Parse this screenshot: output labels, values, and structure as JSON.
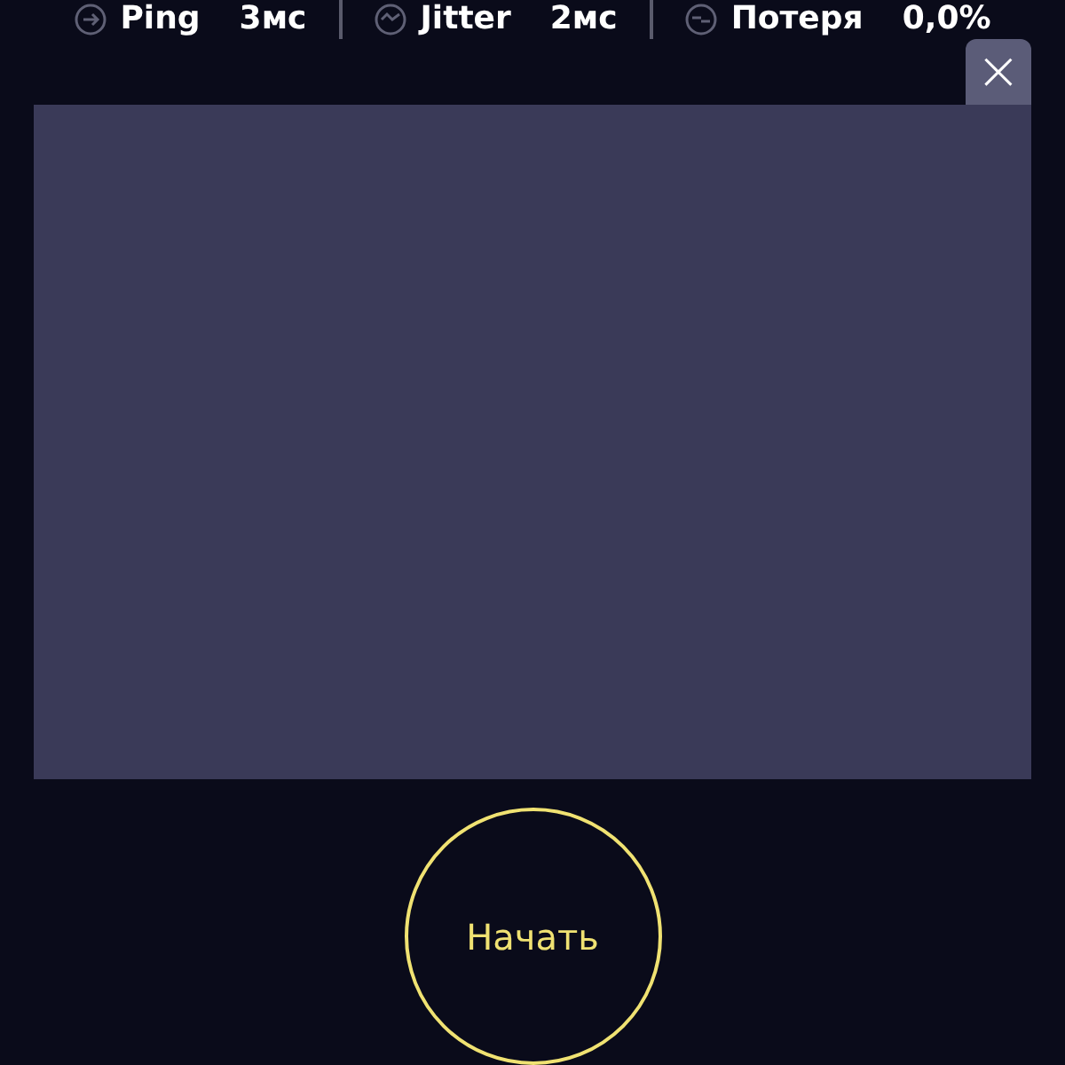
{
  "stats": [
    {
      "label": "Ping",
      "value": "3мс"
    },
    {
      "label": "Jitter",
      "value": "2мс"
    },
    {
      "label": "Потеря",
      "value": "0,0%"
    }
  ],
  "close": {
    "symbol": "×"
  },
  "start_button": {
    "label": "Начать"
  }
}
